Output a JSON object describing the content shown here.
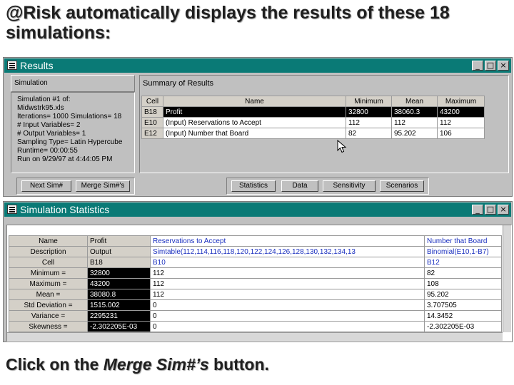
{
  "slide": {
    "title": "@Risk automatically displays the results of these 18 simulations:",
    "caption_pre": "Click on the ",
    "caption_em": "Merge Sim#’s",
    "caption_post": " button."
  },
  "results_window": {
    "title": "Results",
    "simulation_label": "Simulation",
    "summary_label": "Summary of Results",
    "info": [
      "Simulation #1 of:",
      "Midwstrk95.xls",
      "Iterations= 1000    Simulations= 18",
      "# Input Variables= 2",
      "# Output Variables= 1",
      "Sampling Type= Latin Hypercube",
      "Runtime= 00:00:55",
      "Run on 9/29/97 at 4:44:05 PM"
    ],
    "summary_columns": [
      "Cell",
      "Name",
      "Minimum",
      "Mean",
      "Maximum"
    ],
    "summary_rows": [
      {
        "cell": "B18",
        "name": "Profit",
        "min": "32800",
        "mean": "38060.3",
        "max": "43200"
      },
      {
        "cell": "E10",
        "name": "(Input) Reservations to Accept",
        "min": "112",
        "mean": "112",
        "max": "112"
      },
      {
        "cell": "E12",
        "name": "(Input) Number that Board",
        "min": "82",
        "mean": "95.202",
        "max": "106"
      }
    ],
    "buttons": {
      "next_sim": "Next Sim#",
      "merge_sims": "Merge Sim#'s",
      "statistics": "Statistics",
      "data": "Data",
      "sensitivity": "Sensitivity",
      "scenarios": "Scenarios"
    }
  },
  "stats_window": {
    "title": "Simulation Statistics",
    "headers": [
      "Name",
      "Profit",
      "Reservations to Accept",
      "Number that Board"
    ],
    "rows": [
      {
        "label": "Description",
        "c1": "Output",
        "c2": "Simtable(112,114,116,118,120,122,124,126,128,130,132,134,13",
        "c3": "Binomial(E10,1-B7)"
      },
      {
        "label": "Cell",
        "c1": "B18",
        "c2": "B10",
        "c3": "B12"
      },
      {
        "label": "Minimum =",
        "c1": "32800",
        "c2": "112",
        "c3": "82"
      },
      {
        "label": "Maximum =",
        "c1": "43200",
        "c2": "112",
        "c3": "108"
      },
      {
        "label": "Mean =",
        "c1": "38080.8",
        "c2": "112",
        "c3": "95.202"
      },
      {
        "label": "Std Deviation =",
        "c1": "1515.002",
        "c2": "0",
        "c3": "3.707505"
      },
      {
        "label": "Variance =",
        "c1": "2295231",
        "c2": "0",
        "c3": "14.3452"
      },
      {
        "label": "Skewness =",
        "c1": "-2.302205E-03",
        "c2": "0",
        "c3": "-2.302205E-03"
      }
    ]
  },
  "window_controls": {
    "minimize": "_",
    "maximize": "□",
    "close": "×"
  }
}
